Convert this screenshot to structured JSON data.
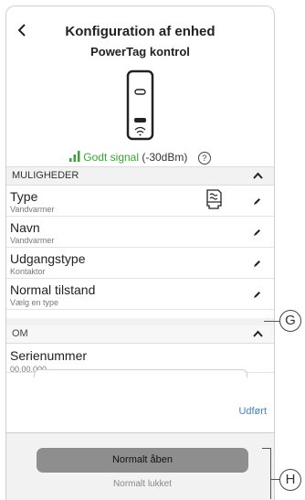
{
  "header": {
    "back_icon": "chevron-left-icon",
    "title": "Konfiguration af enhed",
    "subtitle": "PowerTag kontrol",
    "signal_good": "Godt signal",
    "signal_value": "(-30dBm)",
    "signal_color": "#3aa335"
  },
  "sections": {
    "muligheder": "MULIGHEDER",
    "om": "OM"
  },
  "rows": [
    {
      "label": "Type",
      "value": "Vandvarmer"
    },
    {
      "label": "Navn",
      "value": "Vandvarmer"
    },
    {
      "label": "Udgangstype",
      "value": "Kontaktor"
    },
    {
      "label": "Normal tilstand",
      "value": "Vælg en type"
    }
  ],
  "serial": {
    "label": "Serienummer",
    "value": "00.00.000"
  },
  "sheet": {
    "done": "Udført",
    "selected": "Normalt åben",
    "other": "Normalt lukket"
  },
  "callouts": {
    "g": "G",
    "h": "H"
  },
  "colors": {
    "accent": "#4a7fc1",
    "picker_selected": "#8e8e8e"
  }
}
